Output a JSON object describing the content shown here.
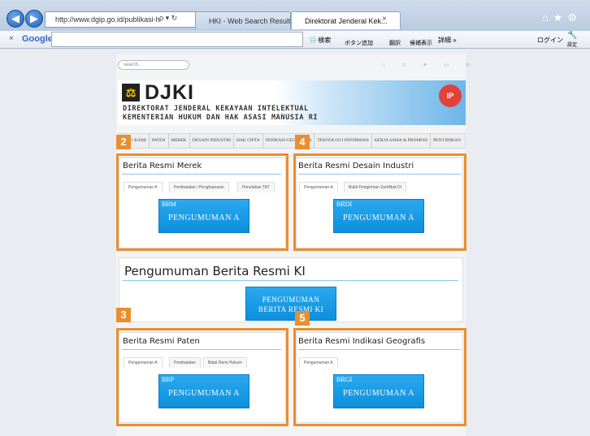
{
  "browser": {
    "back": "back",
    "forward": "forward",
    "address": "http://www.dgip.go.id/publikasi-hki",
    "address_icons": "ρ ▾ ↻",
    "tabs": [
      {
        "label": "HKI - Web Search Result"
      },
      {
        "label": "Direktorat Jenderal Kek..."
      }
    ],
    "titlebar_icons": "⌂★⚙",
    "toolbar": {
      "close": "×",
      "google": "Google",
      "search": "検索",
      "add_button": "ボタン追加",
      "translate": "翻訳",
      "bookmark": "候補表示",
      "details": "詳細 »",
      "login": "ログイン",
      "settings": "設定"
    }
  },
  "site": {
    "search_placeholder": "search...",
    "logo": "DJKI",
    "subtitle_1": "DIREKTORAT JENDERAL KEKAYAAN INTELEKTUAL",
    "subtitle_2": "KEMENTERIAN HUKUM DAN HAK ASASI MANUSIA RI",
    "nav": [
      "TANG KAMI",
      "PATEN",
      "MEREK",
      "DESAIN INDUSTRI",
      "HAK CIPTA",
      "INDIKASI GEOGRAFIS",
      "TEKNOLOGI INFORMASI",
      "KERJA SAMA & PROMOSI",
      "PENYIDIKAN"
    ],
    "main_title": "Pengumuman Berita Resmi KI",
    "main_button": "PENGUMUMAN BERITA RESMI KI",
    "panels": [
      {
        "title": "Berita Resmi Merek",
        "tabs": [
          "Pengumuman A",
          "Pembatalan / Penghapusan",
          "Penolakan TAT"
        ],
        "code": "BRM",
        "button": "PENGUMUMAN A",
        "badge": "2"
      },
      {
        "title": "Berita Resmi Desain Industri",
        "tabs": [
          "Pengumuman A",
          "Bukti Pengiriman Sertifikat DI"
        ],
        "code": "BRDI",
        "button": "PENGUMUMAN A",
        "badge": "4"
      },
      {
        "title": "Berita Resmi Paten",
        "tabs": [
          "Pengumuman A",
          "Pembatalan",
          "Batal Demi Hukum"
        ],
        "code": "BRP",
        "button": "PENGUMUMAN A",
        "badge": "3"
      },
      {
        "title": "Berita Resmi Indikasi Geografis",
        "tabs": [
          "Pengumuman A"
        ],
        "code": "BRGI",
        "button": "PENGUMUMAN A",
        "badge": "5"
      }
    ]
  },
  "colors": {
    "highlight": "#e98f2f",
    "button": "#1a9de6",
    "accent_line": "#8cc7ef"
  }
}
